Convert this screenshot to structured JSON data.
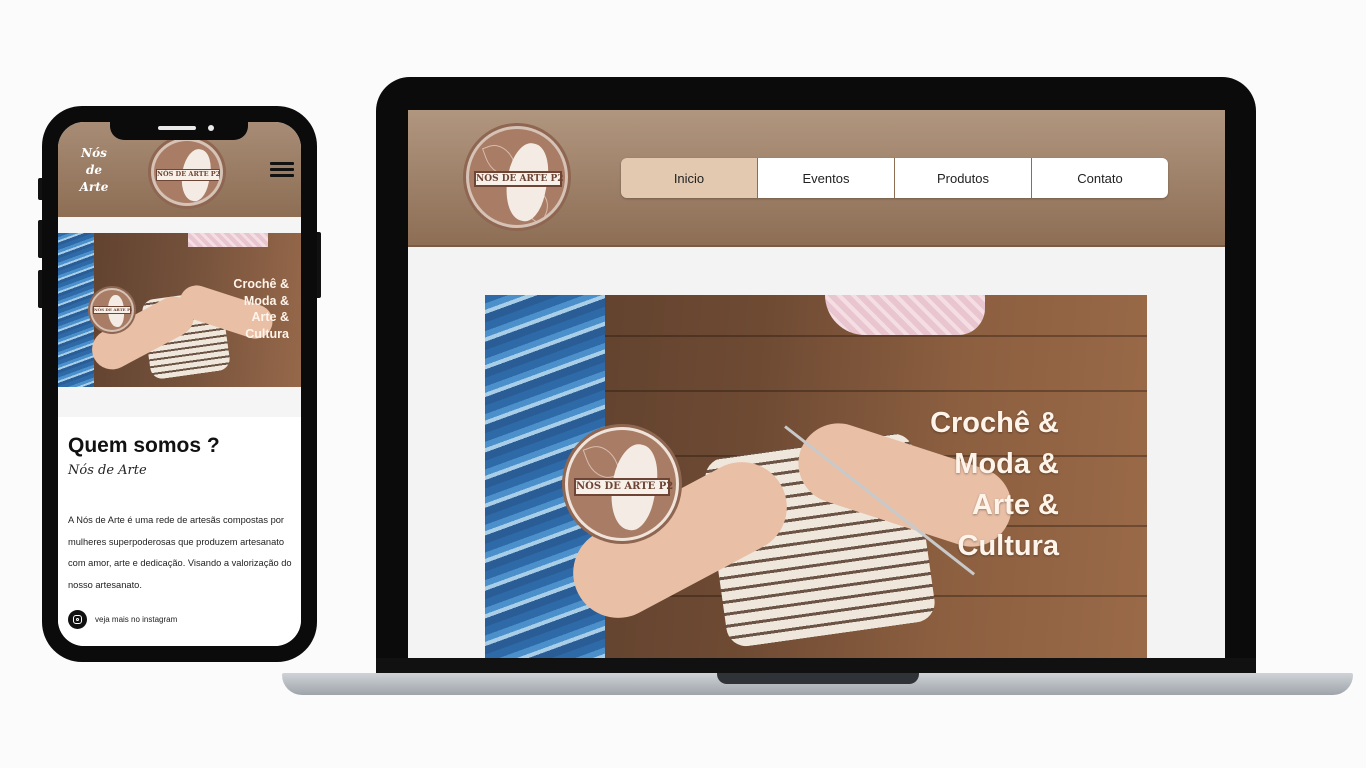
{
  "laptop": {
    "logo": {
      "text": "NÓS DE ARTE P2"
    },
    "nav": [
      {
        "label": "Inicio",
        "active": true
      },
      {
        "label": "Eventos",
        "active": false
      },
      {
        "label": "Produtos",
        "active": false
      },
      {
        "label": "Contato",
        "active": false
      }
    ],
    "hero": {
      "logo_text": "NÓS DE ARTE P2",
      "lines": [
        "Crochê &",
        "Moda &",
        "Arte &",
        "Cultura"
      ]
    }
  },
  "mobile": {
    "brand": [
      "Nós",
      "de",
      "Arte"
    ],
    "logo_text": "NÓS DE ARTE P2",
    "hero": {
      "logo_text": "NÓS DE ARTE P2",
      "lines": [
        "Crochê &",
        "Moda &",
        "Arte &",
        "Cultura"
      ]
    },
    "about": {
      "title": "Quem somos ?",
      "subtitle": "Nós de Arte",
      "text": "A Nós de Arte é uma rede de artesãs compostas por mulheres superpoderosas que produzem artesanato com amor, arte e dedicação. Visando a valorização do nosso artesanato.",
      "instagram_label": "veja mais no instagram"
    }
  },
  "colors": {
    "header_brown": "#8d6e55",
    "active_tab": "#e3c9b0",
    "logo_brown": "#a97c66"
  }
}
